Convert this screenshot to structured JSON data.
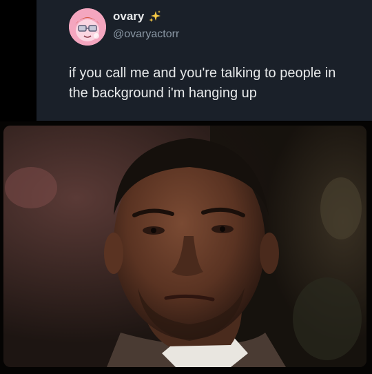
{
  "tweet": {
    "display_name": "ovary",
    "handle": "@ovaryactorr",
    "text": "if you call me and you're talking to people in the background i'm hanging up",
    "name_emoji_icon": "sparkles-icon",
    "avatar_icon": "cartoon-character-avatar"
  },
  "colors": {
    "card_background": "#1a2029",
    "page_background": "#000000",
    "name_text": "#e7e9ea",
    "handle_text": "#8b98a5",
    "sparkle": "#f6c945"
  },
  "media": {
    "kind": "photo",
    "subject": "man-in-suit-looking-at-camera"
  }
}
